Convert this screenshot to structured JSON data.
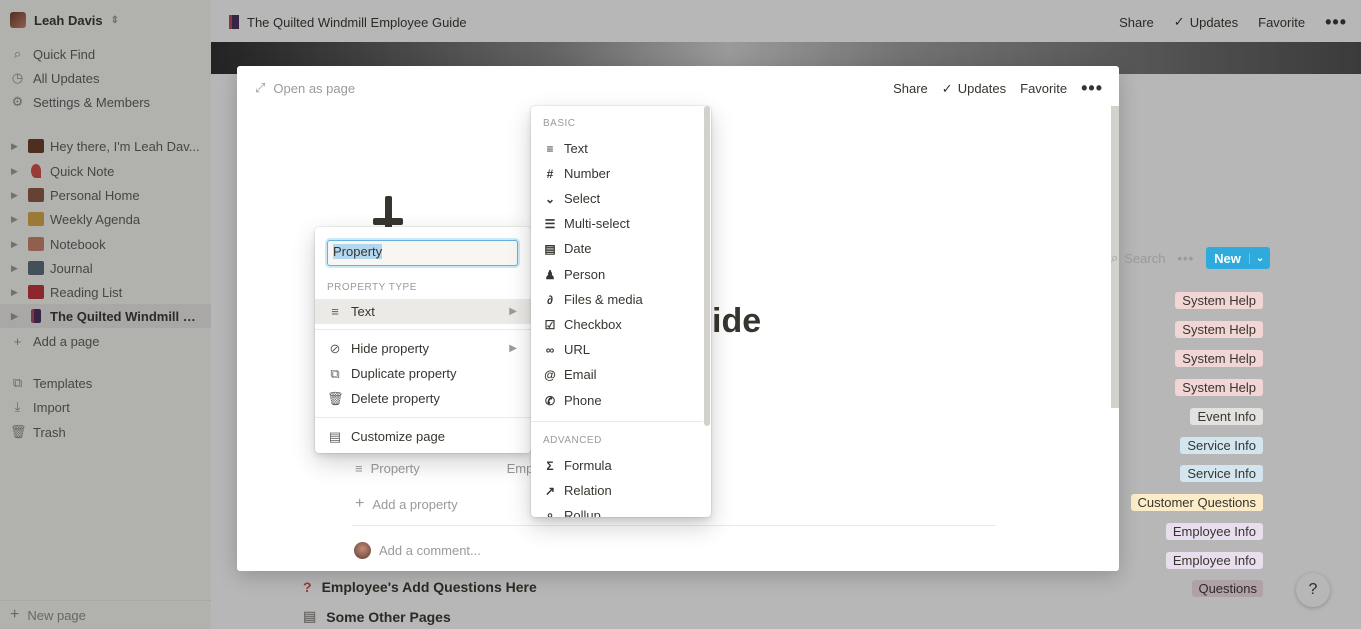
{
  "workspace": {
    "name": "Leah Davis"
  },
  "sidebar": {
    "links": [
      {
        "icon": "search-icon",
        "label": "Quick Find"
      },
      {
        "icon": "clock-icon",
        "label": "All Updates"
      },
      {
        "icon": "gear-icon",
        "label": "Settings & Members"
      }
    ],
    "pages": [
      {
        "label": "Hey there, I'm Leah Dav...",
        "color": "#6b3b2a"
      },
      {
        "label": "Quick Note",
        "color": "#d44c47"
      },
      {
        "label": "Personal Home",
        "color": "#8a5a44"
      },
      {
        "label": "Weekly Agenda",
        "color": "#d9a648"
      },
      {
        "label": "Notebook",
        "color": "#c9826b"
      },
      {
        "label": "Journal",
        "color": "#5c6b7a"
      },
      {
        "label": "Reading List",
        "color": "#c0303a"
      },
      {
        "label": "The Quilted Windmill E...",
        "color": "#4a2f5c"
      }
    ],
    "add_page": "Add a page",
    "bottom_links": [
      {
        "icon": "templates-icon",
        "label": "Templates"
      },
      {
        "icon": "import-icon",
        "label": "Import"
      },
      {
        "icon": "trash-icon",
        "label": "Trash"
      }
    ],
    "new_page": "New page"
  },
  "topbar": {
    "breadcrumb": "The Quilted Windmill Employee Guide",
    "share": "Share",
    "updates": "Updates",
    "favorite": "Favorite",
    "more": "•••"
  },
  "background": {
    "rows": [
      {
        "icon": "question-icon",
        "label": "Employee's Add Questions Here"
      },
      {
        "icon": "page-icon",
        "label": "Some Other Pages"
      }
    ],
    "help": "?"
  },
  "modal": {
    "open_as_page": "Open as page",
    "share": "Share",
    "updates": "Updates",
    "favorite": "Favorite",
    "more": "•••",
    "title_partial": "ide",
    "search": "Search",
    "db_more": "•••",
    "new_button": "New",
    "property_row_label": "Property",
    "property_row_value": "Emp",
    "add_property": "Add a property",
    "comment_placeholder": "Add a comment...",
    "tags": [
      {
        "label": "System Help",
        "bg": "#f2d5d5"
      },
      {
        "label": "System Help",
        "bg": "#f2d5d5"
      },
      {
        "label": "System Help",
        "bg": "#f2d5d5"
      },
      {
        "label": "System Help",
        "bg": "#f2d5d5"
      },
      {
        "label": "Event Info",
        "bg": "#e3e2e0"
      },
      {
        "label": "Service Info",
        "bg": "#d3e5ef"
      },
      {
        "label": "Service Info",
        "bg": "#d3e5ef"
      },
      {
        "label": "Customer Questions",
        "bg": "#fdecc8"
      },
      {
        "label": "Employee Info",
        "bg": "#e8deee"
      },
      {
        "label": "Employee Info",
        "bg": "#e8deee"
      },
      {
        "label": "Questions",
        "bg": "#f5e0e9"
      }
    ]
  },
  "property_menu": {
    "name_value": "Property",
    "type_section": "PROPERTY TYPE",
    "type_value": "Text",
    "hide": "Hide property",
    "duplicate": "Duplicate property",
    "delete": "Delete property",
    "customize": "Customize page"
  },
  "type_menu": {
    "basic_label": "BASIC",
    "basic": [
      {
        "icon": "text-icon",
        "glyph": "≡",
        "label": "Text"
      },
      {
        "icon": "number-icon",
        "glyph": "#",
        "label": "Number"
      },
      {
        "icon": "select-icon",
        "glyph": "⌄",
        "label": "Select"
      },
      {
        "icon": "multiselect-icon",
        "glyph": "☰",
        "label": "Multi-select"
      },
      {
        "icon": "date-icon",
        "glyph": "▤",
        "label": "Date"
      },
      {
        "icon": "person-icon",
        "glyph": "♟",
        "label": "Person"
      },
      {
        "icon": "attachment-icon",
        "glyph": "∂",
        "label": "Files & media"
      },
      {
        "icon": "checkbox-icon",
        "glyph": "☑",
        "label": "Checkbox"
      },
      {
        "icon": "link-icon",
        "glyph": "∞",
        "label": "URL"
      },
      {
        "icon": "email-icon",
        "glyph": "@",
        "label": "Email"
      },
      {
        "icon": "phone-icon",
        "glyph": "✆",
        "label": "Phone"
      }
    ],
    "advanced_label": "ADVANCED",
    "advanced": [
      {
        "icon": "formula-icon",
        "glyph": "Σ",
        "label": "Formula"
      },
      {
        "icon": "relation-icon",
        "glyph": "↗",
        "label": "Relation"
      },
      {
        "icon": "rollup-icon",
        "glyph": "⌕",
        "label": "Rollup"
      }
    ]
  }
}
